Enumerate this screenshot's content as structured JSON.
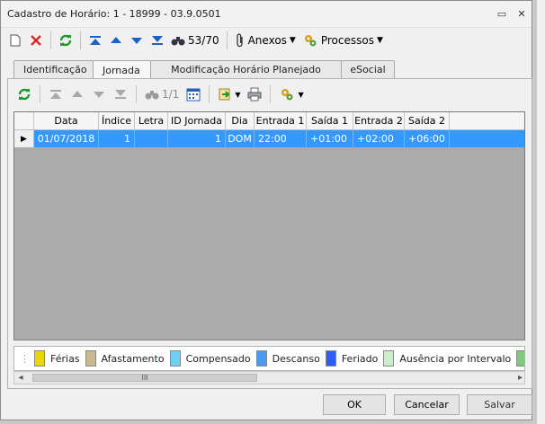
{
  "window": {
    "title": "Cadastro de Horário: 1 - 18999 - 03.9.0501",
    "minimize": "▭",
    "close": "✕"
  },
  "toolbar": {
    "counter": "53/70",
    "attachments_label": "Anexos",
    "processes_label": "Processos"
  },
  "tabs": [
    "Identificação",
    "Jornada",
    "Modificação Horário Planejado",
    "eSocial"
  ],
  "active_tab": "Jornada",
  "subtoolbar": {
    "counter": "1/1"
  },
  "grid": {
    "columns": [
      "Data",
      "Índice",
      "Letra",
      "ID Jornada",
      "Dia",
      "Entrada 1",
      "Saída 1",
      "Entrada 2",
      "Saída 2"
    ],
    "rows": [
      [
        "01/07/2018",
        "1",
        "",
        "1",
        "DOM",
        "22:00",
        "+01:00",
        "+02:00",
        "+06:00"
      ]
    ]
  },
  "legend": [
    {
      "label": "Férias",
      "color": "#e6d800"
    },
    {
      "label": "Afastamento",
      "color": "#c8b98f"
    },
    {
      "label": "Compensado",
      "color": "#6ecff6"
    },
    {
      "label": "Descanso",
      "color": "#4a9af0"
    },
    {
      "label": "Feriado",
      "color": "#2c5ff6"
    },
    {
      "label": "Ausência por Intervalo",
      "color": "#c9eec9"
    },
    {
      "label": "",
      "color": "#7fc97f"
    }
  ],
  "scroll": {
    "thumb_grip": "III",
    "left_arrow": "◂",
    "right_arrow": "▸"
  },
  "buttons": {
    "ok": "OK",
    "cancel": "Cancelar",
    "save": "Salvar"
  }
}
